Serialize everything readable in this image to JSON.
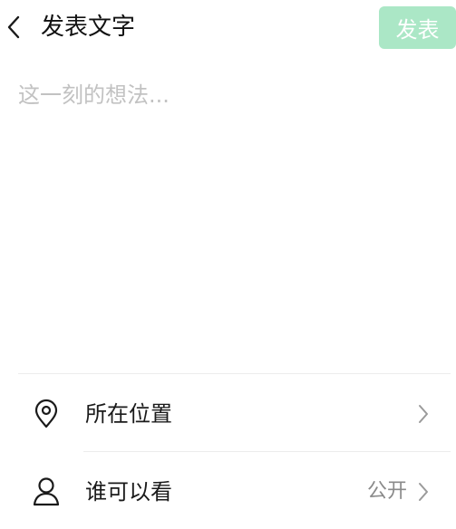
{
  "header": {
    "title": "发表文字",
    "back_icon": "chevron-left-icon",
    "publish_label": "发表",
    "publish_color": "#9de3bd"
  },
  "composer": {
    "placeholder": "这一刻的想法...",
    "value": ""
  },
  "options": {
    "location": {
      "icon": "location-pin-icon",
      "label": "所在位置",
      "value": ""
    },
    "visibility": {
      "icon": "person-icon",
      "label": "谁可以看",
      "value": "公开"
    }
  }
}
